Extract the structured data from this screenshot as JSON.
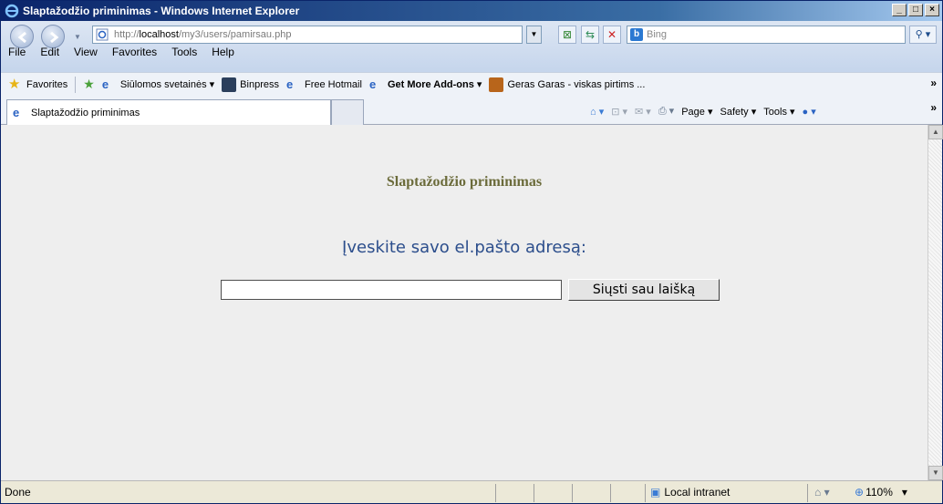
{
  "window": {
    "title": "Slaptažodžio priminimas - Windows Internet Explorer",
    "btn_min": "_",
    "btn_max": "□",
    "btn_close": "×"
  },
  "address": {
    "prefix": "http://",
    "host": "localhost",
    "path": "/my3/users/pamirsau.php"
  },
  "search": {
    "placeholder": "Bing"
  },
  "menu": [
    "File",
    "Edit",
    "View",
    "Favorites",
    "Tools",
    "Help"
  ],
  "favorites": {
    "label": "Favorites",
    "items": [
      "Siūlomos svetainės ▾",
      "Binpress",
      "Free Hotmail",
      "Get More Add-ons ▾",
      "Geras Garas - viskas pirtims ..."
    ]
  },
  "tab": {
    "title": "Slaptažodžio priminimas"
  },
  "command_bar": {
    "page": "Page ▾",
    "safety": "Safety ▾",
    "tools": "Tools ▾"
  },
  "page": {
    "heading": "Slaptažodžio priminimas",
    "prompt": "Įveskite savo el.pašto adresą:",
    "email_value": "",
    "button_label": "Siųsti sau laišką"
  },
  "status": {
    "text": "Done",
    "zone": "Local intranet",
    "zoom": "110%"
  },
  "colors": {
    "heading": "#6b6b3a",
    "prompt": "#2c4e8c",
    "content_bg": "#eeeeee"
  }
}
